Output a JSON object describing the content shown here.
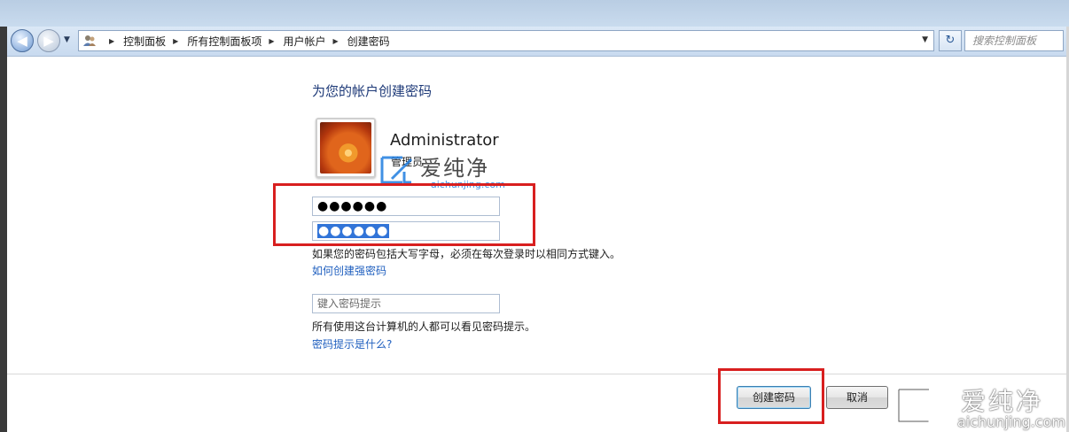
{
  "toolbar": {
    "back_glyph": "◀",
    "forward_glyph": "▶",
    "dropdown_glyph": "▼",
    "breadcrumb": [
      "控制面板",
      "所有控制面板项",
      "用户帐户",
      "创建密码"
    ],
    "refresh_glyph": "↻",
    "search_placeholder": "搜索控制面板"
  },
  "main": {
    "title": "为您的帐户创建密码",
    "account": {
      "name": "Administrator",
      "role": "管理员"
    },
    "new_password": "●●●●●●",
    "confirm_password": "●●●●●●",
    "caps_note": "如果您的密码包括大写字母，必须在每次登录时以相同方式键入。",
    "strong_password_link": "如何创建强密码",
    "hint_placeholder": "键入密码提示",
    "hint_note": "所有使用这台计算机的人都可以看见密码提示。",
    "hint_link": "密码提示是什么?"
  },
  "buttons": {
    "create": "创建密码",
    "cancel": "取消"
  },
  "watermarks": {
    "brand": "爱纯净",
    "domain_mid": "aichunjing.com",
    "domain_corner": "aichunjing.com"
  },
  "colors": {
    "highlight": "#d81f1f",
    "link": "#1f5fbf",
    "title": "#1e3a78",
    "selection": "#3174d8"
  },
  "icons": [
    "back-arrow-icon",
    "forward-arrow-icon",
    "users-icon",
    "refresh-icon"
  ]
}
